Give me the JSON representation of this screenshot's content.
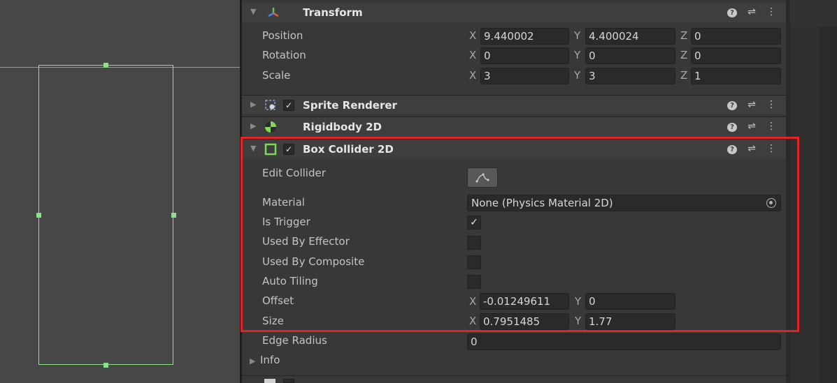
{
  "transform": {
    "title": "Transform",
    "position": {
      "label": "Position",
      "x": "9.440002",
      "y": "4.400024",
      "z": "0"
    },
    "rotation": {
      "label": "Rotation",
      "x": "0",
      "y": "0",
      "z": "0"
    },
    "scale": {
      "label": "Scale",
      "x": "3",
      "y": "3",
      "z": "1"
    }
  },
  "axis": {
    "x": "X",
    "y": "Y",
    "z": "Z"
  },
  "components": {
    "sprite_renderer": "Sprite Renderer",
    "rigidbody": "Rigidbody 2D",
    "box_collider": "Box Collider 2D"
  },
  "box_collider": {
    "edit_collider": "Edit Collider",
    "material": {
      "label": "Material",
      "value": "None (Physics Material 2D)"
    },
    "is_trigger": {
      "label": "Is Trigger",
      "checked": true
    },
    "used_by_effector": {
      "label": "Used By Effector",
      "checked": false
    },
    "used_by_composite": {
      "label": "Used By Composite",
      "checked": false
    },
    "auto_tiling": {
      "label": "Auto Tiling",
      "checked": false
    },
    "offset": {
      "label": "Offset",
      "x": "-0.01249611",
      "y": "0"
    },
    "size": {
      "label": "Size",
      "x": "0.7951485",
      "y": "1.77"
    },
    "edge_radius": {
      "label": "Edge Radius",
      "value": "0"
    },
    "info": "Info"
  },
  "glyphs": {
    "check": "✓",
    "help": "?",
    "settings": "⇌",
    "menu": "⋮",
    "fold_open": "▼",
    "fold_closed": "▶"
  },
  "colors": {
    "highlight": "#e02428",
    "collider_green": "#8ee08e"
  }
}
